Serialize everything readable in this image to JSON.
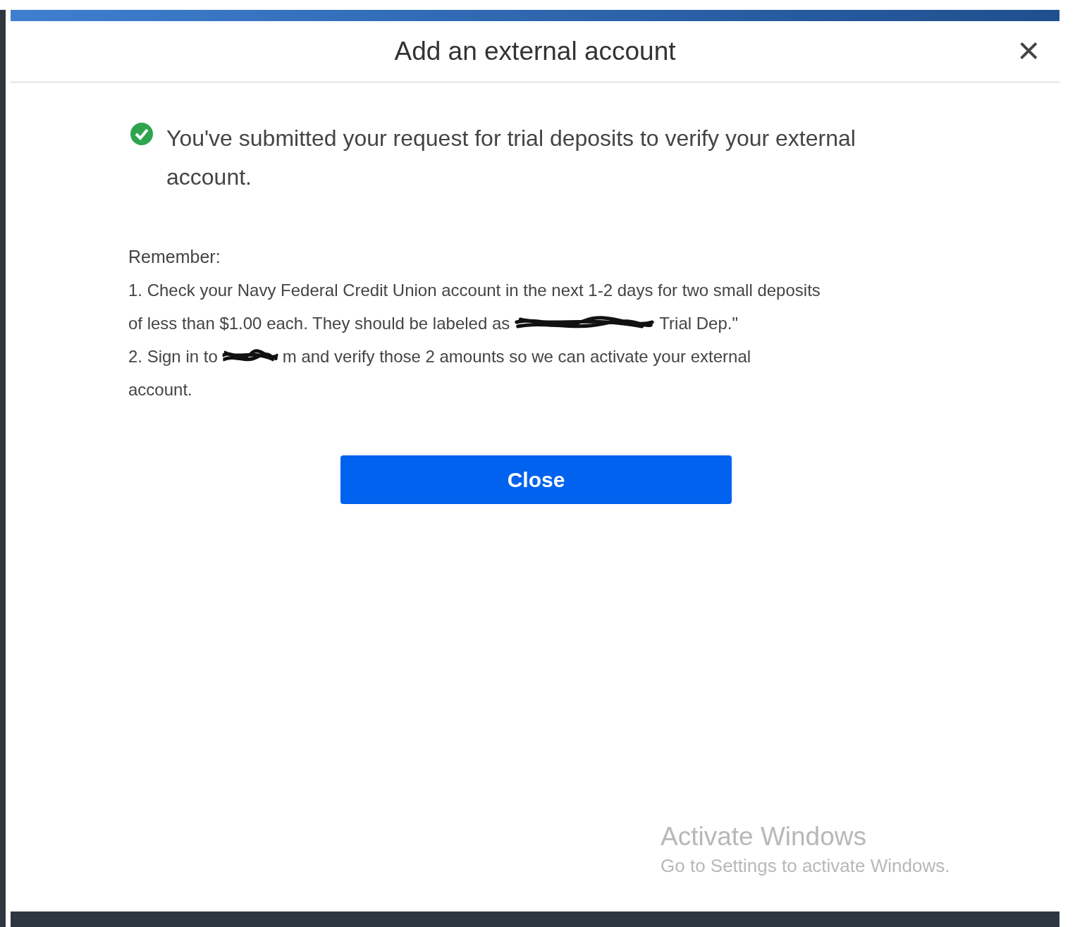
{
  "dialog": {
    "title": "Add an external account",
    "close_label": "×"
  },
  "message": {
    "text": "You've submitted your request for trial deposits to verify your external account."
  },
  "remember": {
    "label": "Remember:",
    "lines": [
      {
        "parts": [
          {
            "kind": "text",
            "text": "1. Check your Navy Federal Credit Union account in the next 1-2 days for two small deposits"
          }
        ]
      },
      {
        "parts": [
          {
            "kind": "text",
            "text": "of less than $1.00 each. They should be labeled as"
          },
          {
            "kind": "redaction"
          },
          {
            "kind": "text",
            "text": "Trial Dep.\""
          }
        ]
      },
      {
        "parts": [
          {
            "kind": "text",
            "text": "2. Sign in to"
          },
          {
            "kind": "redaction"
          },
          {
            "kind": "text",
            "text": "m and verify those 2 amounts so we can activate your external"
          }
        ]
      },
      {
        "parts": [
          {
            "kind": "text",
            "text": "account."
          }
        ]
      }
    ]
  },
  "button": {
    "label": "Close"
  },
  "os_notice": {
    "title": "Activate Windows",
    "subtitle": "Go to Settings to activate Windows."
  }
}
